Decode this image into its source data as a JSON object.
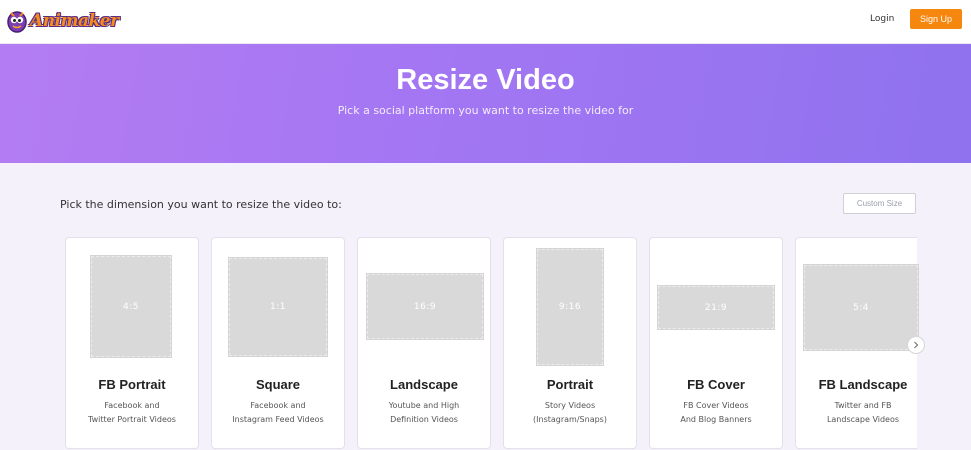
{
  "navbar": {
    "logo_text": "Animaker",
    "login_label": "Login",
    "signup_label": "Sign Up",
    "accent_color": "#f5870f"
  },
  "hero": {
    "title": "Resize Video",
    "subtitle": "Pick a social platform you want to resize the video for",
    "gradient_colors": [
      "#b47cf2",
      "#8f72ee"
    ]
  },
  "section": {
    "label": "Pick the dimension you want to resize the video to:",
    "custom_size_label": "Custom Size"
  },
  "cards": [
    {
      "ratio": "4:5",
      "title": "FB Portrait",
      "desc": "Facebook and\nTwitter Portrait Videos"
    },
    {
      "ratio": "1:1",
      "title": "Square",
      "desc": "Facebook and\nInstagram Feed Videos"
    },
    {
      "ratio": "16:9",
      "title": "Landscape",
      "desc": "Youtube and High\nDefinition Videos"
    },
    {
      "ratio": "9:16",
      "title": "Portrait",
      "desc": "Story Videos\n(Instagram/Snaps)"
    },
    {
      "ratio": "21:9",
      "title": "FB Cover",
      "desc": "FB Cover Videos\nAnd Blog Banners"
    },
    {
      "ratio": "5:4",
      "title": "FB Landscape",
      "desc": "Twitter and FB\nLandscape Videos"
    }
  ],
  "icons": {
    "next": "chevron-right-icon",
    "logo": "animaker-logo-icon"
  }
}
